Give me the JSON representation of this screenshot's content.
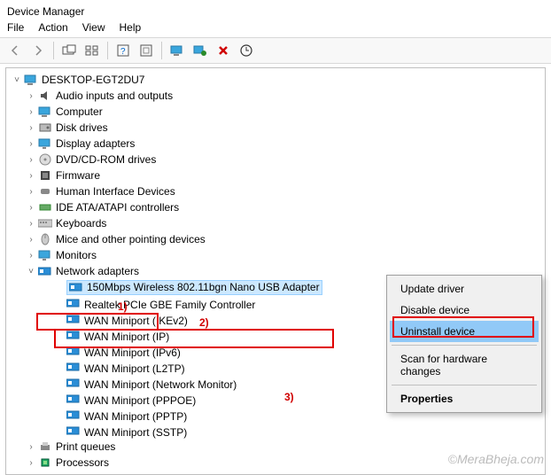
{
  "window": {
    "title": "Device Manager"
  },
  "menu": {
    "file": "File",
    "action": "Action",
    "view": "View",
    "help": "Help"
  },
  "toolbar_icons": {
    "back": "back-arrow-icon",
    "fwd": "forward-arrow-icon",
    "show": "show-connect-icon",
    "tree": "folders-icon",
    "help": "help-icon",
    "refresh": "refresh-icon",
    "monitor": "monitor-icon",
    "scan": "scan-hardware-icon",
    "remove": "remove-icon",
    "update": "update-driver-icon"
  },
  "root": {
    "label": "DESKTOP-EGT2DU7"
  },
  "categories": [
    {
      "label": "Audio inputs and outputs",
      "icon": "speaker"
    },
    {
      "label": "Computer",
      "icon": "computer"
    },
    {
      "label": "Disk drives",
      "icon": "disk"
    },
    {
      "label": "Display adapters",
      "icon": "display"
    },
    {
      "label": "DVD/CD-ROM drives",
      "icon": "dvd"
    },
    {
      "label": "Firmware",
      "icon": "firmware"
    },
    {
      "label": "Human Interface Devices",
      "icon": "hid"
    },
    {
      "label": "IDE ATA/ATAPI controllers",
      "icon": "ide"
    },
    {
      "label": "Keyboards",
      "icon": "keyboard"
    },
    {
      "label": "Mice and other pointing devices",
      "icon": "mouse"
    },
    {
      "label": "Monitors",
      "icon": "monitor"
    }
  ],
  "network": {
    "label": "Network adapters",
    "devices": [
      {
        "label": "150Mbps Wireless 802.11bgn Nano USB Adapter",
        "selected": true
      },
      {
        "label": "Realtek PCIe GBE Family Controller"
      },
      {
        "label": "WAN Miniport (IKEv2)"
      },
      {
        "label": "WAN Miniport (IP)"
      },
      {
        "label": "WAN Miniport (IPv6)"
      },
      {
        "label": "WAN Miniport (L2TP)"
      },
      {
        "label": "WAN Miniport (Network Monitor)"
      },
      {
        "label": "WAN Miniport (PPPOE)"
      },
      {
        "label": "WAN Miniport (PPTP)"
      },
      {
        "label": "WAN Miniport (SSTP)"
      }
    ]
  },
  "after": [
    {
      "label": "Print queues",
      "icon": "printer"
    },
    {
      "label": "Processors",
      "icon": "cpu"
    }
  ],
  "context_menu": {
    "update": "Update driver",
    "disable": "Disable device",
    "uninstall": "Uninstall device",
    "scan": "Scan for hardware changes",
    "properties": "Properties"
  },
  "callouts": {
    "c1": "1)",
    "c2": "2)",
    "c3": "3)"
  },
  "watermark": "©MeraBheja.com"
}
